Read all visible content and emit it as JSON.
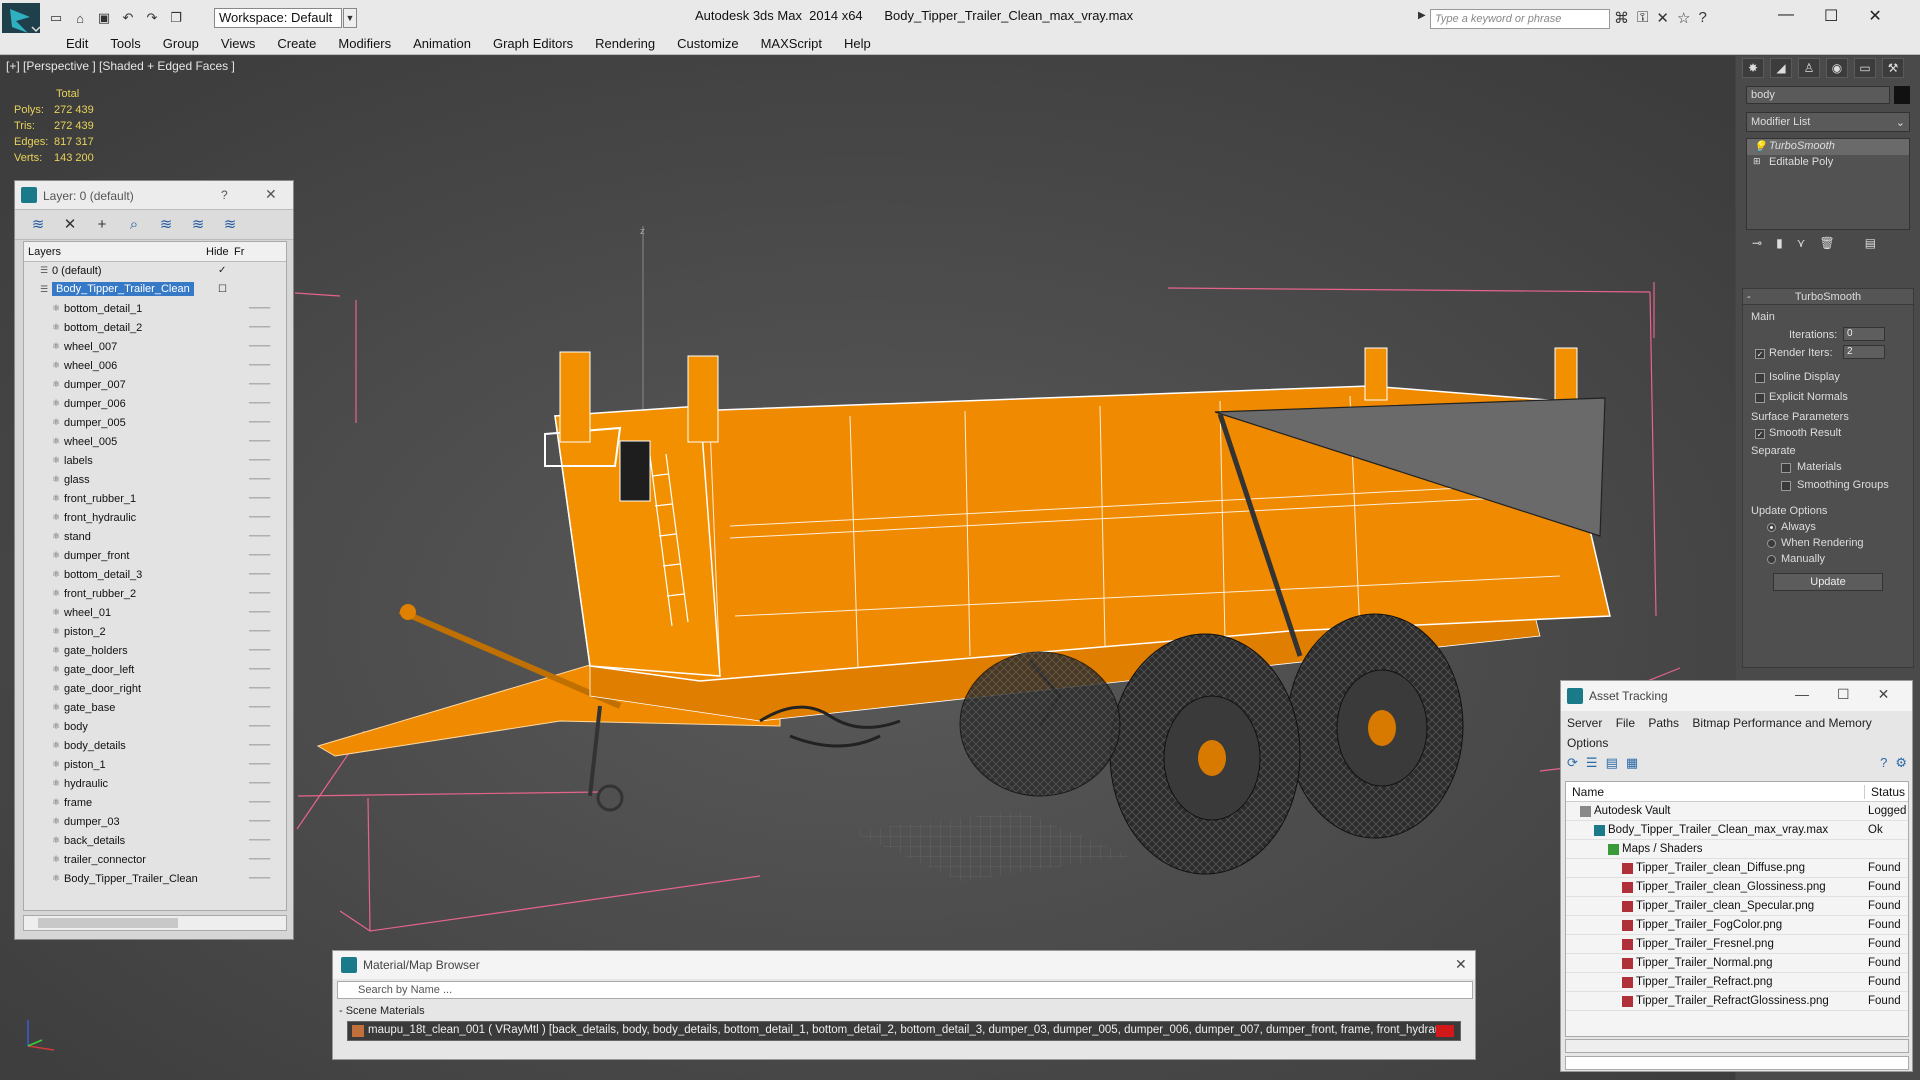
{
  "titlebar": {
    "workspace_label": "Workspace: Default",
    "app_name": "Autodesk 3ds Max  2014 x64",
    "file_name": "Body_Tipper_Trailer_Clean_max_vray.max",
    "search_placeholder": "Type a keyword or phrase"
  },
  "menu": [
    "Edit",
    "Tools",
    "Group",
    "Views",
    "Create",
    "Modifiers",
    "Animation",
    "Graph Editors",
    "Rendering",
    "Customize",
    "MAXScript",
    "Help"
  ],
  "viewport": {
    "label": "[+] [Perspective ] [Shaded + Edged Faces ]",
    "stats": {
      "header": "Total",
      "rows": [
        {
          "label": "Polys:",
          "value": "272 439"
        },
        {
          "label": "Tris:",
          "value": "272 439"
        },
        {
          "label": "Edges:",
          "value": "817 317"
        },
        {
          "label": "Verts:",
          "value": "143 200"
        }
      ]
    },
    "colors": {
      "trailer": "#f08a00",
      "tire": "#2c2c2c",
      "cover": "#6a6a6a",
      "bbox": "#e6648a",
      "wire": "#ffffff"
    }
  },
  "layers": {
    "title": "Layer: 0 (default)",
    "help": "?",
    "col_layers": "Layers",
    "col_hide": "Hide",
    "col_fr": "Fr",
    "items": [
      "0 (default)",
      "Body_Tipper_Trailer_Clean",
      "bottom_detail_1",
      "bottom_detail_2",
      "wheel_007",
      "wheel_006",
      "dumper_007",
      "dumper_006",
      "dumper_005",
      "wheel_005",
      "labels",
      "glass",
      "front_rubber_1",
      "front_hydraulic",
      "stand",
      "dumper_front",
      "bottom_detail_3",
      "front_rubber_2",
      "wheel_01",
      "piston_2",
      "gate_holders",
      "gate_door_left",
      "gate_door_right",
      "gate_base",
      "body",
      "body_details",
      "piston_1",
      "hydraulic",
      "frame",
      "dumper_03",
      "back_details",
      "trailer_connector",
      "Body_Tipper_Trailer_Clean"
    ]
  },
  "command_panel": {
    "object_name": "body",
    "modifier_list": "Modifier List",
    "stack": [
      "TurboSmooth",
      "Editable Poly"
    ],
    "turbosmooth": {
      "title": "TurboSmooth",
      "main": "Main",
      "iterations_label": "Iterations:",
      "iterations_value": "0",
      "render_iters_label": "Render Iters:",
      "render_iters_value": "2",
      "isoline": "Isoline Display",
      "explicit": "Explicit Normals",
      "surface_params": "Surface Parameters",
      "smooth_result": "Smooth Result",
      "separate": "Separate",
      "materials": "Materials",
      "smoothing_groups": "Smoothing Groups",
      "update_options": "Update Options",
      "always": "Always",
      "when_rendering": "When Rendering",
      "manually": "Manually",
      "update_btn": "Update"
    }
  },
  "asset_tracking": {
    "title": "Asset Tracking",
    "menu": [
      "Server",
      "File",
      "Paths",
      "Bitmap Performance and Memory",
      "Options"
    ],
    "col_name": "Name",
    "col_status": "Status",
    "rows": [
      {
        "name": "Autodesk Vault",
        "status": "Logged",
        "indent": 0
      },
      {
        "name": "Body_Tipper_Trailer_Clean_max_vray.max",
        "status": "Ok",
        "indent": 1
      },
      {
        "name": "Maps / Shaders",
        "status": "",
        "indent": 2
      },
      {
        "name": "Tipper_Trailer_clean_Diffuse.png",
        "status": "Found",
        "indent": 3
      },
      {
        "name": "Tipper_Trailer_clean_Glossiness.png",
        "status": "Found",
        "indent": 3
      },
      {
        "name": "Tipper_Trailer_clean_Specular.png",
        "status": "Found",
        "indent": 3
      },
      {
        "name": "Tipper_Trailer_FogColor.png",
        "status": "Found",
        "indent": 3
      },
      {
        "name": "Tipper_Trailer_Fresnel.png",
        "status": "Found",
        "indent": 3
      },
      {
        "name": "Tipper_Trailer_Normal.png",
        "status": "Found",
        "indent": 3
      },
      {
        "name": "Tipper_Trailer_Refract.png",
        "status": "Found",
        "indent": 3
      },
      {
        "name": "Tipper_Trailer_RefractGlossiness.png",
        "status": "Found",
        "indent": 3
      }
    ]
  },
  "material_browser": {
    "title": "Material/Map Browser",
    "search_placeholder": "Search by Name ...",
    "group": "- Scene Materials",
    "material": "maupu_18t_clean_001  ( VRayMtl )  [back_details, body, body_details, bottom_detail_1, bottom_detail_2, bottom_detail_3, dumper_03, dumper_005, dumper_006, dumper_007, dumper_front, frame, front_hydrau..."
  }
}
